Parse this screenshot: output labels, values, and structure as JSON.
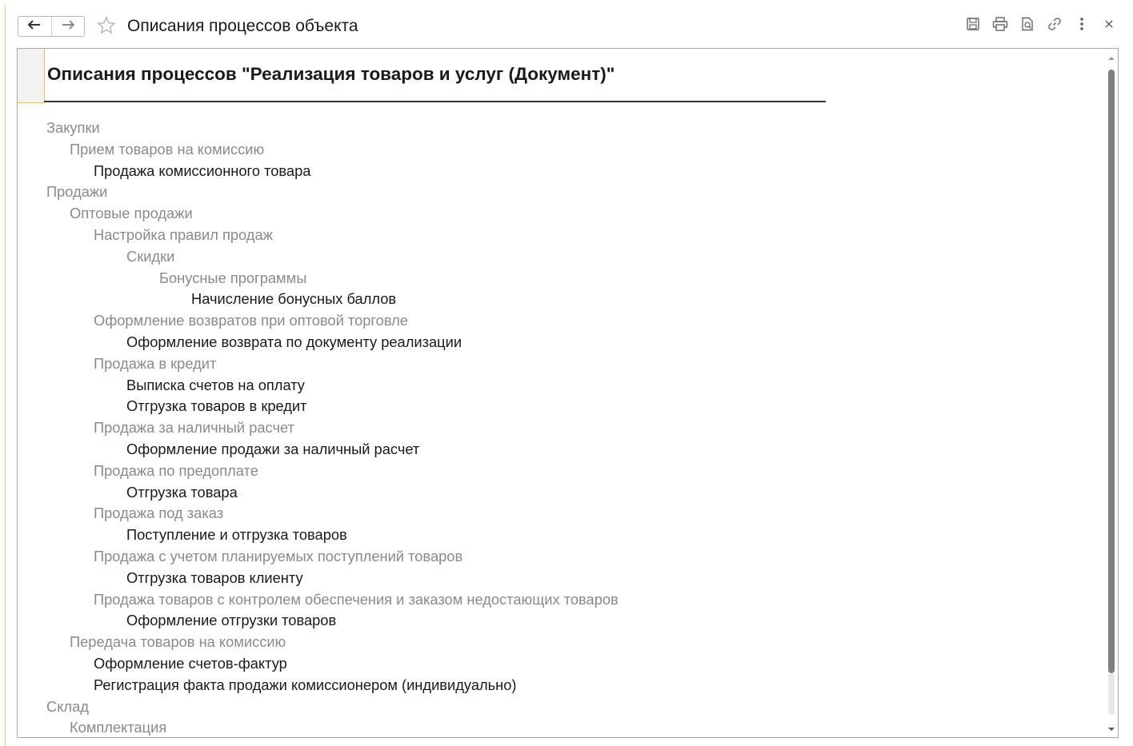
{
  "window": {
    "title": "Описания процессов объекта"
  },
  "document": {
    "heading": "Описания процессов \"Реализация товаров и услуг (Документ)\""
  },
  "tree": [
    {
      "text": "Закупки",
      "level": 0,
      "kind": "group"
    },
    {
      "text": "Прием товаров на комиссию",
      "level": 1,
      "kind": "group"
    },
    {
      "text": "Продажа комиссионного товара",
      "level": 2,
      "kind": "leaf"
    },
    {
      "text": "Продажи",
      "level": 0,
      "kind": "group"
    },
    {
      "text": "Оптовые продажи",
      "level": 1,
      "kind": "group"
    },
    {
      "text": "Настройка правил продаж",
      "level": 2,
      "kind": "group"
    },
    {
      "text": "Скидки",
      "level": 3,
      "kind": "group"
    },
    {
      "text": "Бонусные программы",
      "level": 4,
      "kind": "group"
    },
    {
      "text": "Начисление бонусных баллов",
      "level": 5,
      "kind": "leaf"
    },
    {
      "text": "Оформление возвратов при оптовой торговле",
      "level": 2,
      "kind": "group"
    },
    {
      "text": "Оформление возврата по документу реализации",
      "level": 3,
      "kind": "leaf"
    },
    {
      "text": "Продажа в кредит",
      "level": 2,
      "kind": "group"
    },
    {
      "text": "Выписка счетов на оплату",
      "level": 3,
      "kind": "leaf"
    },
    {
      "text": "Отгрузка товаров в кредит",
      "level": 3,
      "kind": "leaf"
    },
    {
      "text": "Продажа за наличный расчет",
      "level": 2,
      "kind": "group"
    },
    {
      "text": "Оформление продажи за наличный расчет",
      "level": 3,
      "kind": "leaf"
    },
    {
      "text": "Продажа по предоплате",
      "level": 2,
      "kind": "group"
    },
    {
      "text": "Отгрузка товара",
      "level": 3,
      "kind": "leaf"
    },
    {
      "text": "Продажа под заказ",
      "level": 2,
      "kind": "group"
    },
    {
      "text": "Поступление и отгрузка товаров",
      "level": 3,
      "kind": "leaf"
    },
    {
      "text": "Продажа с учетом планируемых поступлений товаров",
      "level": 2,
      "kind": "group"
    },
    {
      "text": "Отгрузка товаров клиенту",
      "level": 3,
      "kind": "leaf"
    },
    {
      "text": "Продажа товаров с контролем обеспечения и заказом недостающих товаров",
      "level": 2,
      "kind": "group"
    },
    {
      "text": "Оформление отгрузки товаров",
      "level": 3,
      "kind": "leaf"
    },
    {
      "text": "Передача товаров на комиссию",
      "level": 1,
      "kind": "group"
    },
    {
      "text": "Оформление счетов-фактур",
      "level": 2,
      "kind": "leaf"
    },
    {
      "text": "Регистрация факта продажи комиссионером (индивидуально)",
      "level": 2,
      "kind": "leaf"
    },
    {
      "text": "Склад",
      "level": 0,
      "kind": "group"
    },
    {
      "text": "Комплектация",
      "level": 1,
      "kind": "group"
    }
  ],
  "icons": {
    "back": "arrow-left-icon",
    "forward": "arrow-right-icon",
    "favorite": "star-icon",
    "save": "save-icon",
    "print": "printer-icon",
    "preview": "print-preview-icon",
    "link": "link-icon",
    "more": "more-vertical-icon",
    "close": "close-icon"
  },
  "scroll": {
    "position_fraction": 0
  }
}
